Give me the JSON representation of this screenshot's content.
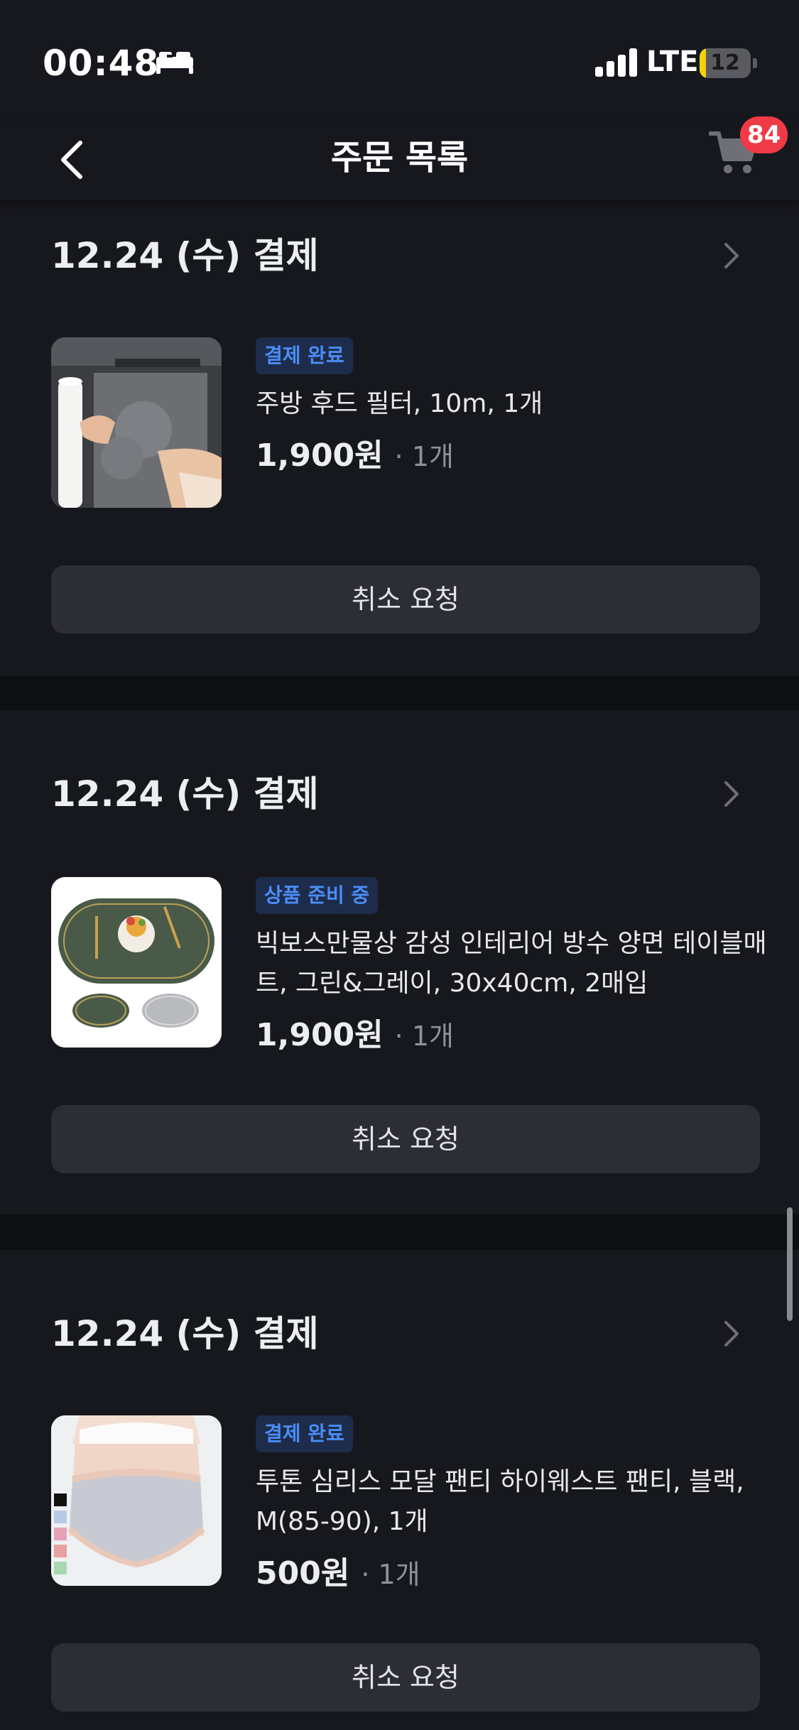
{
  "status_bar": {
    "time": "00:48",
    "network": "LTE",
    "battery_level": "12",
    "battery_fraction": 0.12,
    "focus_icon": "bed-icon"
  },
  "nav": {
    "title": "주문 목록",
    "back_icon": "chevron-left-icon",
    "cart_icon": "cart-icon",
    "cart_badge": "84"
  },
  "colors": {
    "background": "#17181e",
    "separator": "#0e0f13",
    "badge_red": "#f03a47",
    "status_blue": "#4a8df7",
    "status_badge_bg": "#1e2c4b",
    "button_bg": "#2c2d35"
  },
  "orders": [
    {
      "date": "12.24 (수) 결제",
      "status": "결제 완료",
      "product_name": "주방 후드 필터, 10m, 1개",
      "price": "1,900원",
      "quantity": "· 1개",
      "cancel_label": "취소 요청"
    },
    {
      "date": "12.24 (수) 결제",
      "status": "상품 준비 중",
      "product_name": "빅보스만물상 감성 인테리어 방수 양면 테이블매트, 그린&그레이, 30x40cm, 2매입",
      "price": "1,900원",
      "quantity": "· 1개",
      "cancel_label": "취소 요청"
    },
    {
      "date": "12.24 (수) 결제",
      "status": "결제 완료",
      "product_name": "투톤 심리스 모달 팬티 하이웨스트 팬티, 블랙, M(85-90), 1개",
      "price": "500원",
      "quantity": "· 1개",
      "cancel_label": "취소 요청"
    }
  ]
}
